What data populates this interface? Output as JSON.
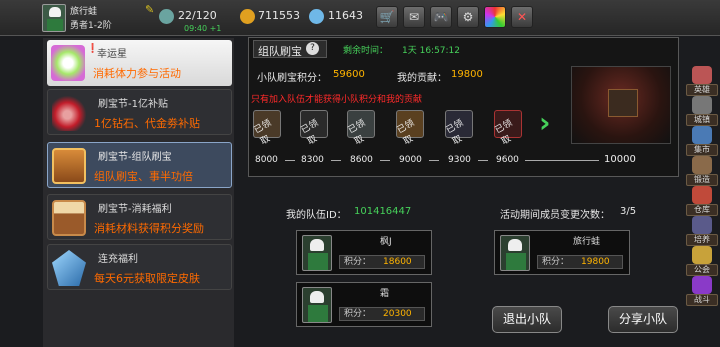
{
  "player": {
    "name": "旅行蛙",
    "title": "勇者1-2阶",
    "energy": "22/120",
    "timer": "09:40 +1",
    "gold": "711553",
    "gems": "11643"
  },
  "toolbar": [
    "shop-icon",
    "mail-icon",
    "gamepad-icon",
    "settings-icon",
    "color-wheel-icon",
    "close-icon"
  ],
  "events": [
    {
      "title": "幸运星",
      "desc": "消耗体力参与活动",
      "icon": "star-icon"
    },
    {
      "title": "刷宝节-1亿补贴",
      "desc": "1亿钻石、代金劵补贴",
      "icon": "red-flag-icon"
    },
    {
      "title": "刷宝节-组队刷宝",
      "desc": "组队刷宝、事半功倍",
      "icon": "treasure-chest-icon"
    },
    {
      "title": "刷宝节-消耗福利",
      "desc": "消耗材料获得积分奖励",
      "icon": "open-chest-icon"
    },
    {
      "title": "连充福利",
      "desc": "每天6元获取限定皮肤",
      "icon": "crystal-icon"
    }
  ],
  "panel": {
    "title": "组队刷宝",
    "remaining_label": "剩余时间：",
    "remaining": "1天 16:57:12",
    "team_score_label": "小队刷宝积分：",
    "team_score": "59600",
    "my_contrib_label": "我的贡献：",
    "my_contrib": "19800",
    "notice": "只有加入队伍才能获得小队积分和我的贡献",
    "claimed": "已领取",
    "milestones": [
      "8000",
      "8300",
      "8600",
      "9000",
      "9300",
      "9600",
      "10000"
    ]
  },
  "team": {
    "id_label": "我的队伍ID：",
    "id": "101416447",
    "changes_label": "活动期间成员变更次数：",
    "changes": "3/5",
    "score_label": "积分："
  },
  "members": [
    {
      "name": "枫J",
      "score": "18600"
    },
    {
      "name": "霜",
      "score": "20300"
    },
    {
      "name": "旅行蛙",
      "score": "19800"
    }
  ],
  "buttons": {
    "leave": "退出小队",
    "share": "分享小队"
  },
  "sidebar": [
    "英雄",
    "城镇",
    "集市",
    "锻造",
    "仓库",
    "培养",
    "公会",
    "战斗"
  ],
  "colors": {
    "accent": "#ff6a00",
    "highlight": "#ffb400",
    "green": "#46d15a",
    "red": "#ff2a2a"
  }
}
